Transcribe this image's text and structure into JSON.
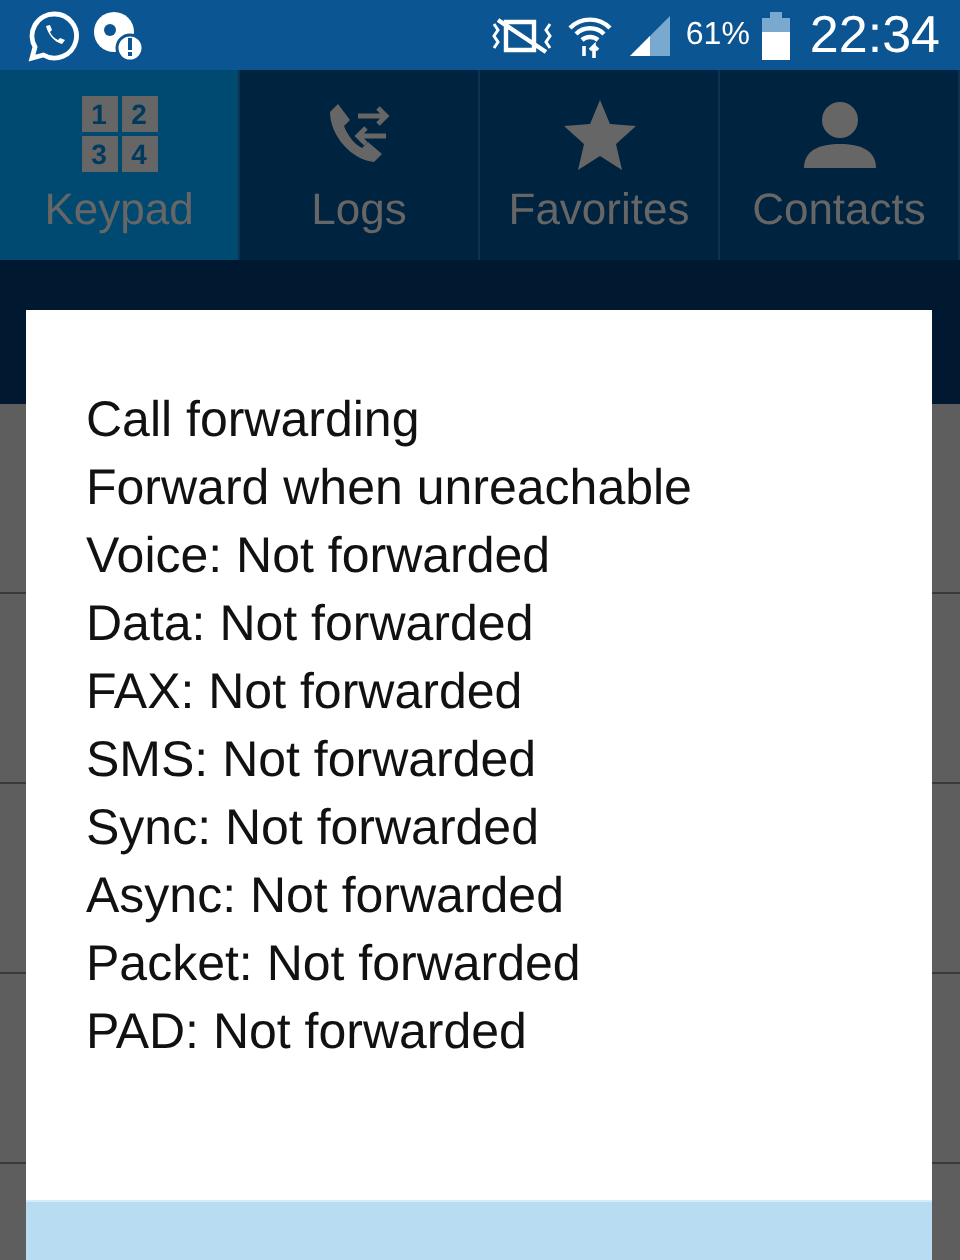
{
  "status_bar": {
    "battery": "61%",
    "time": "22:34"
  },
  "tabs": [
    {
      "label": "Keypad",
      "kind": "keypad",
      "keys": [
        "1",
        "2",
        "3",
        "4"
      ],
      "selected": true
    },
    {
      "label": "Logs",
      "kind": "logs",
      "selected": false
    },
    {
      "label": "Favorites",
      "kind": "favorites",
      "selected": false
    },
    {
      "label": "Contacts",
      "kind": "contacts",
      "selected": false
    }
  ],
  "dialog": {
    "lines": [
      "Call forwarding",
      "Forward when unreachable",
      "Voice: Not forwarded",
      "Data: Not forwarded",
      "FAX: Not forwarded",
      "SMS: Not forwarded",
      "Sync: Not forwarded",
      "Async: Not forwarded",
      "Packet: Not forwarded",
      "PAD: Not forwarded"
    ]
  }
}
